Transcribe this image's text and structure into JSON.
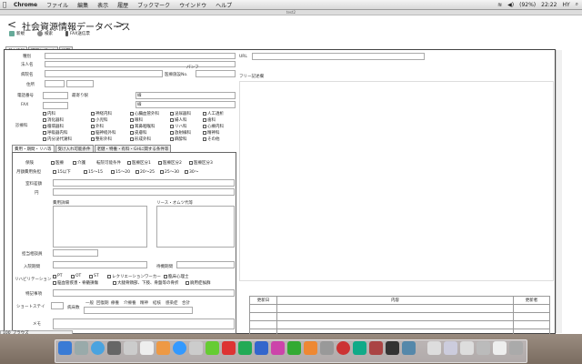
{
  "menubar": {
    "app": "Chrome",
    "items": [
      "ファイル",
      "編集",
      "表示",
      "履歴",
      "ブックマーク",
      "ウインドウ",
      "ヘルプ"
    ],
    "battery": "(92%)",
    "clock": "22:22",
    "user": "HY"
  },
  "window": {
    "title": "test2"
  },
  "header": {
    "back": "<",
    "forward": ">",
    "title": "社会資源情報データベース",
    "toolbar": [
      {
        "label": "新規",
        "icon": "new-icon"
      },
      {
        "label": "検索",
        "icon": "search-icon"
      },
      {
        "label": "FAX送信票",
        "icon": "fax-icon"
      }
    ]
  },
  "tabs": [
    "基本情報",
    "訪問レポート",
    "地図"
  ],
  "form": {
    "type": "種別",
    "name": "法人名",
    "facility": "病院名",
    "address": "住所",
    "phone": "電話番号",
    "fax": "FAX",
    "dept": "診療科",
    "nearest": "最寄り駅",
    "pamphlet": "パンフ",
    "hospital_code": "医療施設No.",
    "url": "URL",
    "free": "フリー記述欄",
    "sub1": "線",
    "sub2": "線"
  },
  "departments": [
    "内科",
    "神経内科",
    "心臓血管外科",
    "泌尿器科",
    "人工透析",
    "消化器科",
    "小児科",
    "眼科",
    "婦人科",
    "歯科",
    "循環器科",
    "外科",
    "耳鼻咽喉科",
    "リハ科",
    "心療内科",
    "呼吸器内科",
    "脳神経外科",
    "皮膚科",
    "放射線科",
    "精神科",
    "内分泌代謝科",
    "整形外科",
    "形成外科",
    "麻酔科",
    "その他"
  ],
  "innertabs": [
    "費用・期間・リハ等",
    "受け入れ可能条件",
    "老健・特養・有料・GHに関する条件等"
  ],
  "inner": {
    "hoken": "保険",
    "hoken_opts": [
      "医療",
      "介護"
    ],
    "tenten": "転院可能条件",
    "iryou_opts": [
      "医療区分1",
      "医療区分2",
      "医療区分3"
    ],
    "monthly": "月額費用負担",
    "monthly_opts": [
      "15以下",
      "15〜15",
      "15〜20",
      "20〜25",
      "25〜30",
      "30〜"
    ],
    "room": "室料差額",
    "yen": "円",
    "cost_detail": "費用詳細",
    "lease": "リース・オムツ代等",
    "doctor": "担当相談員",
    "period": "入院期間",
    "period2": "待機期間",
    "rehab": "リハビリテーション",
    "rehab_opts": [
      "PT",
      "OT",
      "ST",
      "レクリエーションワーカー",
      "臨床心理士"
    ],
    "rehab_opts2": [
      "脳血管疾患・脊髄損傷",
      "大腿骨頸部、下肢、骨盤等の骨折",
      "廃用症候群"
    ],
    "special": "特記事項",
    "short": "ショートステイ",
    "beds": "病床数",
    "beds_cols": [
      "一般",
      "回復期",
      "療養",
      "介療養",
      "精神",
      "結核",
      "感染症",
      "合計"
    ],
    "memo": "メモ"
  },
  "history": {
    "headers": [
      "更新日",
      "内容",
      "更新者"
    ],
    "rows": 5
  },
  "bottom": {
    "label": "ブラウズ",
    "zoom": "100"
  }
}
